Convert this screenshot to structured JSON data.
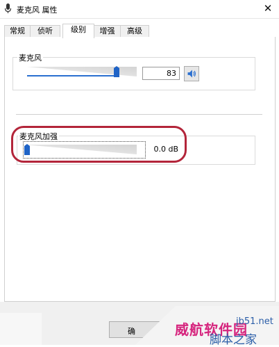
{
  "window": {
    "title": "麦克风 属性",
    "close_glyph": "✕"
  },
  "tabs": [
    {
      "label": "常规",
      "active": false
    },
    {
      "label": "侦听",
      "active": false
    },
    {
      "label": "级别",
      "active": true
    },
    {
      "label": "增强",
      "active": false
    },
    {
      "label": "高级",
      "active": false
    }
  ],
  "microphone": {
    "label": "麦克风",
    "value": "83",
    "level_percent": 83,
    "mute_icon": "speaker-icon"
  },
  "boost": {
    "label": "麦克风加强",
    "value": "0.0 dB",
    "level_percent": 0
  },
  "buttons": {
    "ok_label": "确"
  },
  "watermark": {
    "main": "威航软件园",
    "site": "jb51.net",
    "sub": "脚本之家"
  },
  "colors": {
    "accent": "#2a6fd0",
    "highlight_ring": "#b3253a"
  }
}
